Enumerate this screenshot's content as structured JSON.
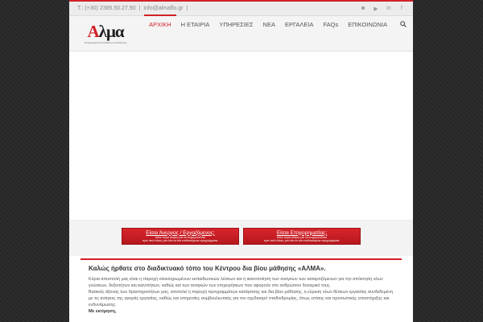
{
  "topbar": {
    "phone": "T.: (+30) 2385.50.27.90",
    "separator": "|",
    "email": "info@almaflo.gr",
    "socials": [
      "user-icon",
      "youtube-icon",
      "linkedin-icon",
      "facebook-icon"
    ]
  },
  "logo": {
    "text_a": "Α",
    "text_rest": "λμα",
    "subtitle": "επαγγελματική εκπαίδευση & κατάρτιση"
  },
  "nav": {
    "items": [
      {
        "label": "ΑΡΧΙΚΗ",
        "active": true
      },
      {
        "label": "Η ΕΤΑΙΡΙΑ",
        "active": false
      },
      {
        "label": "ΥΠΗΡΕΣΙΕΣ",
        "active": false
      },
      {
        "label": "ΝΕΑ",
        "active": false
      },
      {
        "label": "ΕΡΓΑΛΕΙΑ",
        "active": false
      },
      {
        "label": "FAQs",
        "active": false
      },
      {
        "label": "ΕΠΙΚΟΙΝΩΝΙΑ",
        "active": false
      }
    ],
    "search_icon": "search-icon"
  },
  "cta": {
    "left": {
      "title": "Είσαι Άνεργος / Εργαζόμενος;",
      "line1": "Κάνε τώρα αίτηση για να ενημερώνεσαι",
      "line2": "πριν από όλους για όλα τα νέα επιδοτούμενα προγράμματα."
    },
    "right": {
      "title": "Είσαι Επιχειρηματίας;",
      "line1": "Κάνε τώρα αίτηση για να ενημερώνεσαι",
      "line2": "πριν από όλους για όλα τα νέα επιδοτούμενα προγράμματα."
    }
  },
  "content": {
    "welcome": "Καλώς ήρθατε στο διαδικτυακό τόπο του Κέντρου δια βίου μάθησης «ΑΛΜΑ».",
    "p1": "Κύρια αποστολή μας είναι η παροχή ολοκληρωμένων εκπαιδευτικών λύσεων και η ικανοποίηση των αναγκών των καταρτιζόμενων για την απόκτηση νέων γνώσεων, δεξιοτήτων και ικανοτήτων, καθώς και των αναγκών των επιχειρήσεων που αφορούν στο ανθρώπινο δυναμικό τους.",
    "p2": "Βασικός άξονας των δραστηριοτήτων μας, αποτελεί η παροχή προγραμμάτων κατάρτισης και δια βίου μάθησης, η εύρεση νέων θέσεων εργασίας συνδεδεμένη με τις ανάγκες της αγοράς εργασίας, καθώς και υπηρεσίες συμβουλευτικής για τον σχεδιασμό σταδιοδρομίας, όπως επίσης και προσωπικής υποστήριξης και ενδυνάμωσης.",
    "p3": "Με εκτίμηση,"
  }
}
